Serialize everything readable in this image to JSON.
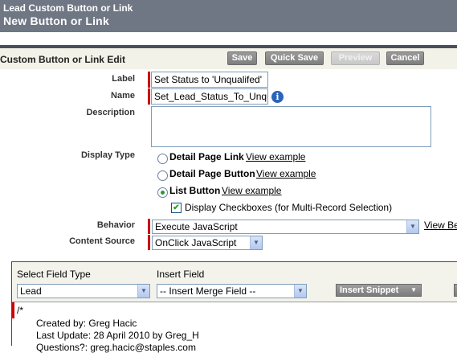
{
  "header": {
    "title": "Lead Custom Button or Link",
    "subtitle": "New Button or Link"
  },
  "toolbar": {
    "section_title": "Custom Button or Link Edit",
    "save_label": "Save",
    "quick_save_label": "Quick Save",
    "preview_label": "Preview",
    "cancel_label": "Cancel"
  },
  "form": {
    "label_label": "Label",
    "label_value": "Set Status to 'Unqualifed'",
    "name_label": "Name",
    "name_value": "Set_Lead_Status_To_Unqualified",
    "info_icon": "i",
    "description_label": "Description",
    "description_value": "",
    "display_type_label": "Display Type",
    "display_types": [
      {
        "label": "Detail Page Link",
        "link": "View example",
        "selected": false
      },
      {
        "label": "Detail Page Button",
        "link": "View example",
        "selected": false
      },
      {
        "label": "List Button",
        "link": "View example",
        "selected": true
      }
    ],
    "checkbox_label": "Display Checkboxes (for Multi-Record Selection)",
    "checkbox_checked": true,
    "behavior_label": "Behavior",
    "behavior_value": "Execute JavaScript",
    "behavior_link": "View Be",
    "content_source_label": "Content Source",
    "content_source_value": "OnClick JavaScript"
  },
  "editor": {
    "field_type_label": "Select Field Type",
    "field_type_value": "Lead",
    "insert_field_label": "Insert Field",
    "insert_field_value": "-- Insert Merge Field --",
    "insert_snippet_label": "Insert Snippet",
    "code_lines": [
      "/*",
      "Created by: Greg Hacic",
      "Last Update: 28 April 2010 by Greg_H",
      "Questions?: greg.hacic@staples.com"
    ]
  },
  "colors": {
    "header_bg": "#6f7684",
    "required_marker": "#cc0000",
    "button_bg": "#8a8a8a"
  }
}
